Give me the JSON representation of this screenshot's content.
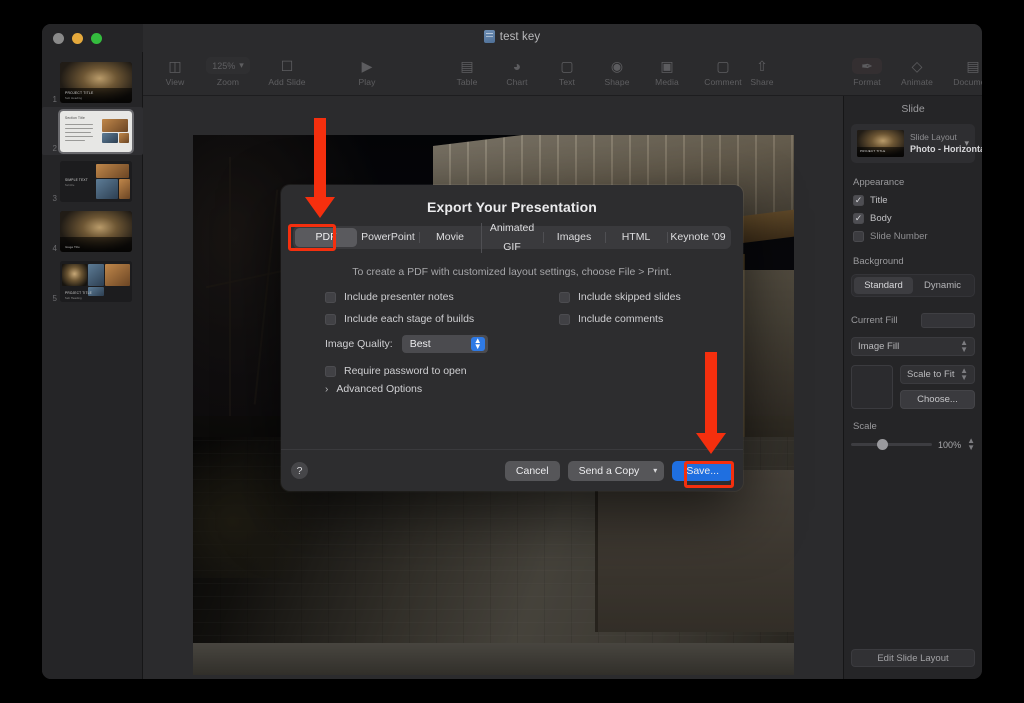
{
  "window": {
    "title": "test key",
    "traffic_lights": [
      "close",
      "minimize",
      "zoom"
    ]
  },
  "toolbar": {
    "items": [
      {
        "label": "View",
        "icon": "sidebar-icon"
      },
      {
        "label": "Zoom",
        "icon": "zoom-dropdown",
        "value": "125%"
      },
      {
        "label": "Add Slide",
        "icon": "add-slide-icon"
      },
      {
        "label": "Play",
        "icon": "play-icon"
      },
      {
        "label": "Table",
        "icon": "table-icon"
      },
      {
        "label": "Chart",
        "icon": "chart-icon"
      },
      {
        "label": "Text",
        "icon": "text-icon"
      },
      {
        "label": "Shape",
        "icon": "shape-icon"
      },
      {
        "label": "Media",
        "icon": "media-icon"
      },
      {
        "label": "Comment",
        "icon": "comment-icon"
      },
      {
        "label": "Share",
        "icon": "share-icon"
      },
      {
        "label": "Format",
        "icon": "format-brush-icon"
      },
      {
        "label": "Animate",
        "icon": "animate-icon"
      },
      {
        "label": "Document",
        "icon": "document-icon"
      }
    ]
  },
  "navigator": {
    "slides": [
      {
        "number": "1",
        "title": "PROJECT TITLE",
        "subtitle": "Sub Heading",
        "selected": false
      },
      {
        "number": "2",
        "title": "Section Title",
        "subtitle": "",
        "selected": true
      },
      {
        "number": "3",
        "title": "SIMPLE TEXT",
        "subtitle": "Subtitle",
        "selected": false
      },
      {
        "number": "4",
        "title": "",
        "subtitle": "Image Title",
        "selected": false
      },
      {
        "number": "5",
        "title": "PROJECT TITLE",
        "subtitle": "Sub Heading",
        "selected": false
      }
    ]
  },
  "inspector": {
    "title": "Slide",
    "layout": {
      "label": "Slide Layout",
      "value": "Photo - Horizontal",
      "chevron": "chevron-down-icon"
    },
    "appearance": {
      "heading": "Appearance",
      "options": [
        {
          "label": "Title",
          "checked": true
        },
        {
          "label": "Body",
          "checked": true
        },
        {
          "label": "Slide Number",
          "checked": false
        }
      ]
    },
    "background": {
      "heading": "Background",
      "segments": [
        {
          "label": "Standard",
          "selected": true
        },
        {
          "label": "Dynamic",
          "selected": false
        }
      ],
      "current_fill_label": "Current Fill",
      "fill_type": "Image Fill",
      "scale_mode": "Scale to Fit",
      "choose_label": "Choose...",
      "scale_label": "Scale",
      "scale_value": "100%"
    },
    "edit_layout_label": "Edit Slide Layout"
  },
  "dialog": {
    "title": "Export Your Presentation",
    "tabs": [
      {
        "label": "PDF",
        "selected": true
      },
      {
        "label": "PowerPoint",
        "selected": false
      },
      {
        "label": "Movie",
        "selected": false
      },
      {
        "label": "Animated GIF",
        "selected": false
      },
      {
        "label": "Images",
        "selected": false
      },
      {
        "label": "HTML",
        "selected": false
      },
      {
        "label": "Keynote '09",
        "selected": false
      }
    ],
    "subtitle": "To create a PDF with customized layout settings, choose File > Print.",
    "options_left": [
      {
        "label": "Include presenter notes",
        "checked": false
      },
      {
        "label": "Include each stage of builds",
        "checked": false
      }
    ],
    "options_right": [
      {
        "label": "Include skipped slides",
        "checked": false
      },
      {
        "label": "Include comments",
        "checked": false
      }
    ],
    "image_quality": {
      "label": "Image Quality:",
      "value": "Best"
    },
    "password_option": {
      "label": "Require password to open",
      "checked": false
    },
    "advanced_options": {
      "label": "Advanced Options",
      "arrow": "chevron-right-icon"
    },
    "help_label": "?",
    "buttons": {
      "cancel": "Cancel",
      "send_a_copy": "Send a Copy",
      "save": "Save..."
    }
  },
  "annotations": {
    "accent_color": "#f52f0e",
    "highlight_pdf_tab": true,
    "highlight_save_button": true,
    "arrows": 2
  }
}
